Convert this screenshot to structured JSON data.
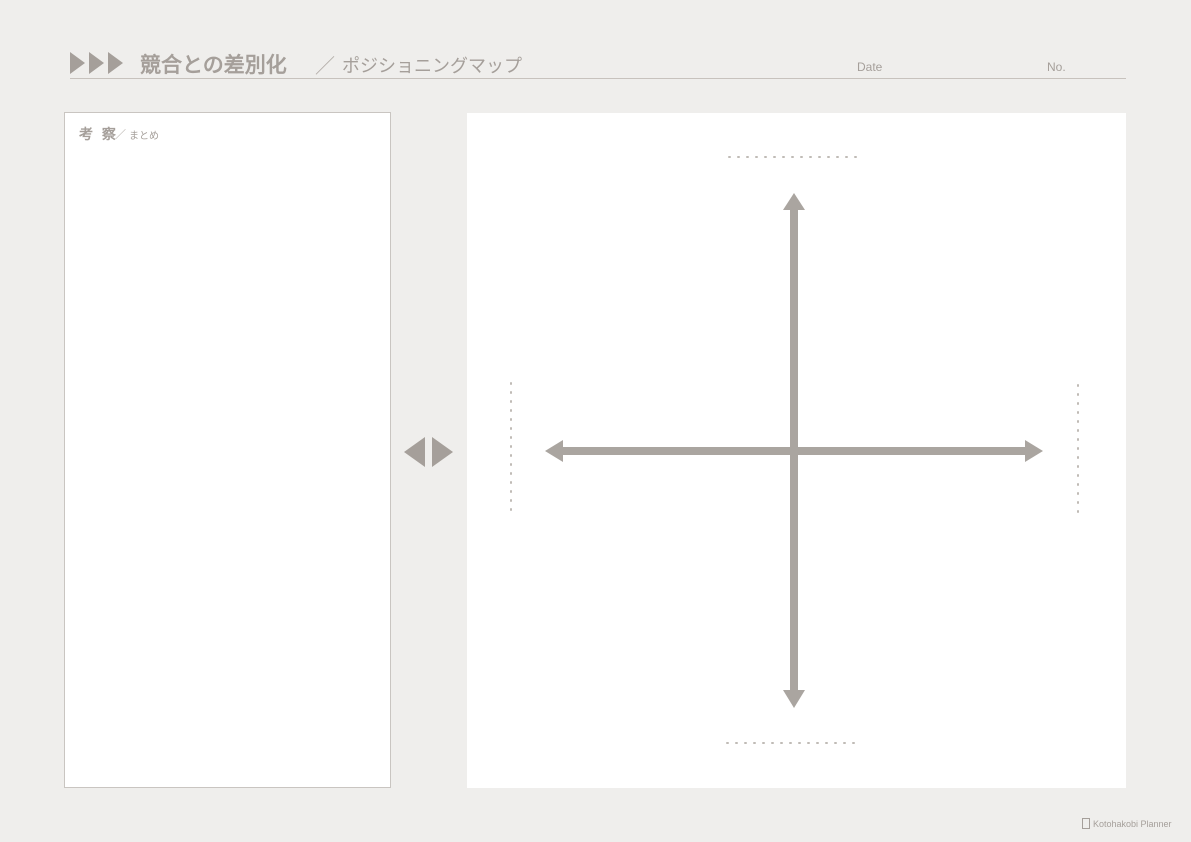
{
  "header": {
    "title": "競合との差別化",
    "separator": "／",
    "subtitle": "ポジショニングマップ",
    "date_label": "Date",
    "no_label": "No."
  },
  "notes": {
    "title": "考 察",
    "separator": "／",
    "subtitle": "まとめ"
  },
  "footer": {
    "brand": "Kotohakobi Planner"
  },
  "colors": {
    "background": "#efeeec",
    "accent": "#a59f9a",
    "panel": "#ffffff"
  },
  "icons": {
    "title_arrows": "triple-right-triangle-icon",
    "swap": "left-right-triangles-icon",
    "brand": "pen-icon"
  }
}
